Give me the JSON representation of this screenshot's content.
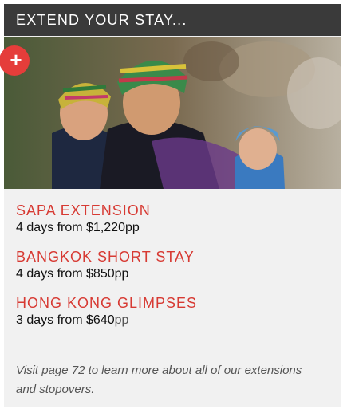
{
  "header": {
    "title": "EXTEND YOUR STAY..."
  },
  "hero": {
    "badge_icon": "plus-icon",
    "badge_symbol": "+"
  },
  "extensions": [
    {
      "title": "SAPA EXTENSION",
      "sub_prefix": "4 days from ",
      "price": "$1,220",
      "unit": "pp"
    },
    {
      "title": "BANGKOK SHORT STAY",
      "sub_prefix": "4 days from ",
      "price": "$850",
      "unit": "pp"
    },
    {
      "title": "HONG KONG GLIMPSES",
      "sub_prefix": "3 days from ",
      "price": "$640",
      "unit": "pp"
    }
  ],
  "note": "Visit page 72 to learn more about all of our extensions and stopovers.",
  "colors": {
    "accent": "#e53d3a",
    "title_red": "#d73a33",
    "header_bg": "#3a3a3a",
    "panel_bg": "#f1f1f1"
  }
}
